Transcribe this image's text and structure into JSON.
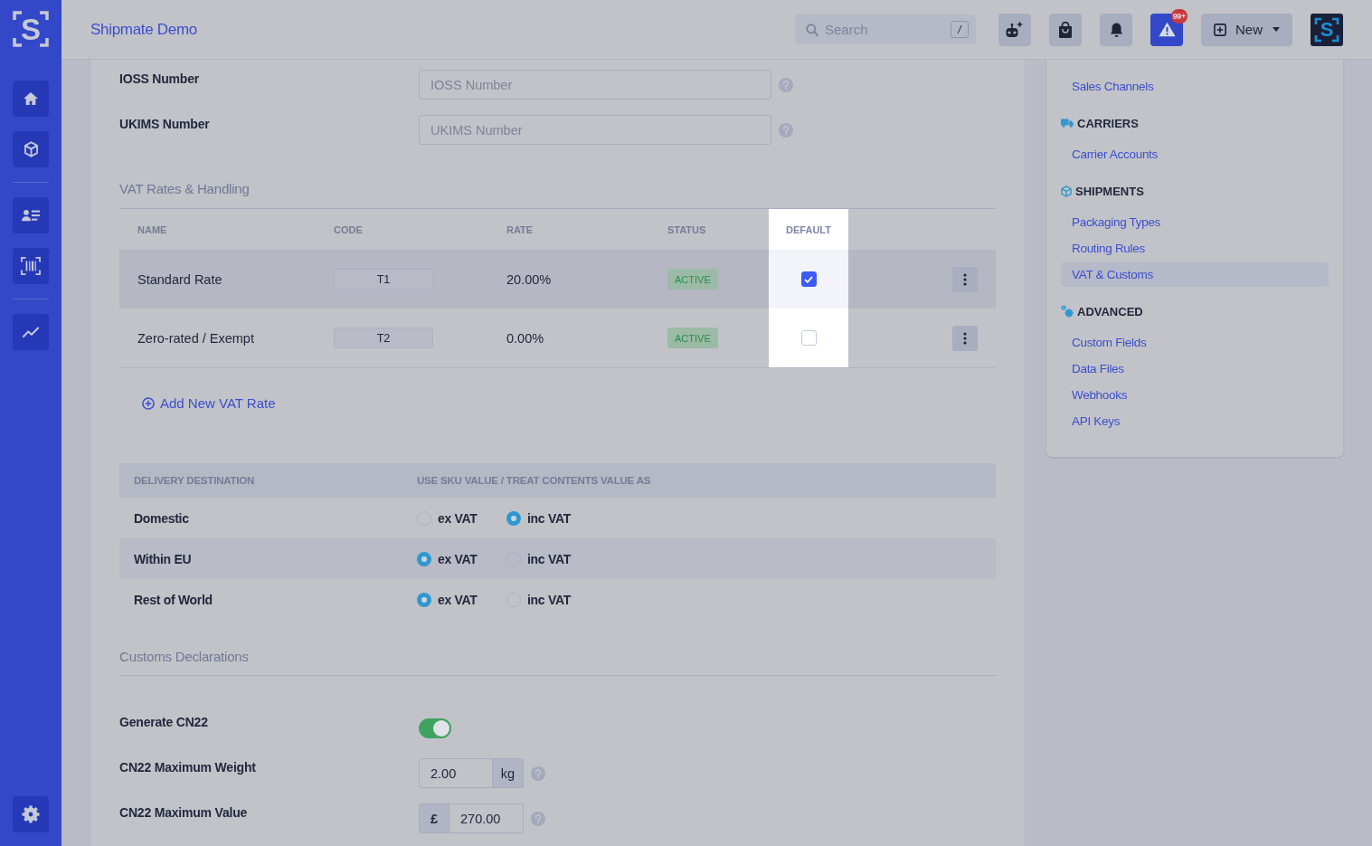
{
  "sidebar": {
    "logo_letter": "S"
  },
  "topbar": {
    "title": "Shipmate Demo",
    "search": {
      "placeholder": "Search",
      "shortcut": "/"
    },
    "alerts_badge": "99+",
    "new_button": "New",
    "account_logo_letter": "S"
  },
  "identifiers": [
    {
      "label": "IOSS Number",
      "placeholder": "IOSS Number",
      "help": true
    },
    {
      "label": "UKIMS Number",
      "placeholder": "UKIMS Number",
      "help": true
    }
  ],
  "vat_rates": {
    "title": "VAT Rates & Handling",
    "columns": [
      {
        "label": "NAME",
        "highlighted": false
      },
      {
        "label": "CODE",
        "highlighted": false
      },
      {
        "label": "RATE",
        "highlighted": false
      },
      {
        "label": "STATUS",
        "highlighted": false
      },
      {
        "label": "DEFAULT",
        "highlighted": true
      }
    ],
    "rows": [
      {
        "name": "Standard Rate",
        "code": "T1",
        "rate": "20.00%",
        "status": "ACTIVE",
        "default": true,
        "hovered": true
      },
      {
        "name": "Zero-rated / Exempt",
        "code": "T2",
        "rate": "0.00%",
        "status": "ACTIVE",
        "default": false,
        "hovered": false
      }
    ],
    "add_link": "Add New VAT Rate"
  },
  "value_treatment": {
    "columns": [
      "DELIVERY DESTINATION",
      "USE SKU VALUE / TREAT CONTENTS VALUE AS"
    ],
    "rows": [
      {
        "destination": "Domestic",
        "options": [
          {
            "label": "ex VAT",
            "selected": false
          },
          {
            "label": "inc VAT",
            "selected": true
          }
        ]
      },
      {
        "destination": "Within EU",
        "options": [
          {
            "label": "ex VAT",
            "selected": true
          },
          {
            "label": "inc VAT",
            "selected": false
          }
        ]
      },
      {
        "destination": "Rest of World",
        "options": [
          {
            "label": "ex VAT",
            "selected": true
          },
          {
            "label": "inc VAT",
            "selected": false
          }
        ]
      }
    ]
  },
  "customs": {
    "title": "Customs Declarations",
    "fields": [
      {
        "kind": "toggle",
        "label": "Generate CN22",
        "on": true,
        "help": false
      },
      {
        "kind": "suffix_input",
        "label": "CN22 Maximum Weight",
        "value": "2.00",
        "addon": "kg",
        "help": true
      },
      {
        "kind": "prefix_input",
        "label": "CN22 Maximum Value",
        "value": "270.00",
        "addon": "£",
        "help": true
      }
    ]
  },
  "settings_nav": {
    "groups": [
      {
        "items": [
          {
            "label": "Sales Channels",
            "selected": false
          }
        ]
      },
      {
        "title": "CARRIERS",
        "items": [
          {
            "label": "Carrier Accounts",
            "selected": false
          }
        ]
      },
      {
        "title": "SHIPMENTS",
        "items": [
          {
            "label": "Packaging Types",
            "selected": false
          },
          {
            "label": "Routing Rules",
            "selected": false
          },
          {
            "label": "VAT & Customs",
            "selected": true
          }
        ]
      },
      {
        "title": "ADVANCED",
        "items": [
          {
            "label": "Custom Fields",
            "selected": false
          },
          {
            "label": "Data Files",
            "selected": false
          },
          {
            "label": "Webhooks",
            "selected": false
          },
          {
            "label": "API Keys",
            "selected": false
          }
        ]
      }
    ]
  }
}
